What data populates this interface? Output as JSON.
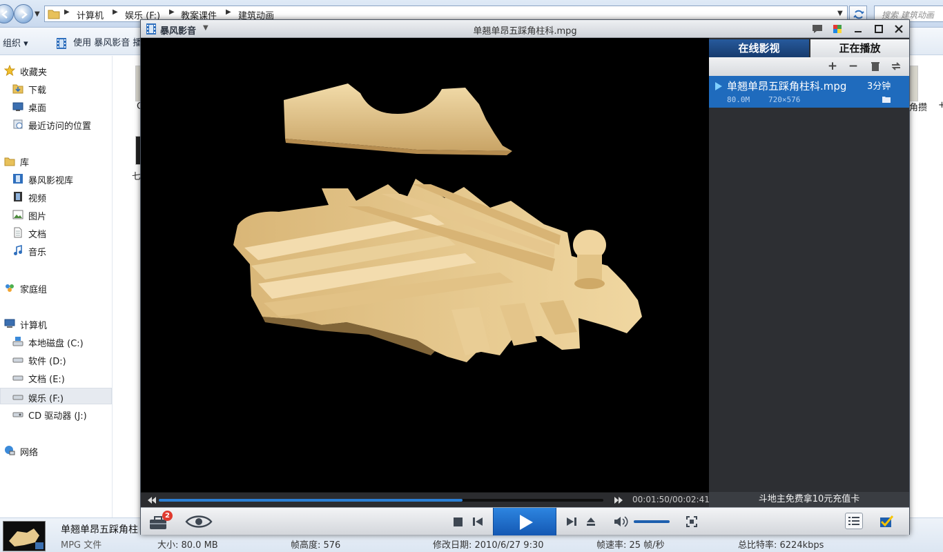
{
  "explorer": {
    "breadcrumbs": [
      "计算机",
      "娱乐 (F:)",
      "教案课件",
      "建筑动画"
    ],
    "search_placeholder": "搜索 建筑动画",
    "toolbar": {
      "organize": "组织",
      "organize_caret": "▾",
      "play_with": "使用 暴风影音 播"
    },
    "nav": {
      "favorites": "收藏夹",
      "downloads": "下载",
      "desktop": "桌面",
      "recent": "最近访问的位置",
      "libraries": "库",
      "baofeng_library": "暴风影视库",
      "videos": "视频",
      "pictures": "图片",
      "documents": "文档",
      "music": "音乐",
      "homegroup": "家庭组",
      "computer": "计算机",
      "drive_c": "本地磁盘 (C:)",
      "drive_d": "软件 (D:)",
      "drive_e": "文档 (E:)",
      "drive_f": "娱乐 (F:)",
      "drive_j": "CD 驱动器 (J:)",
      "network": "网络"
    },
    "file_fragments": {
      "left_1": "C",
      "left_2": "七",
      "right_1": "角攒",
      "right_2": "+"
    },
    "details": {
      "file_name": "单翘单昂五踩角柱",
      "file_type": "MPG 文件",
      "size": "大小: 80.0 MB",
      "frame_height": "帧高度: 576",
      "modified": "修改日期: 2010/6/27 9:30",
      "frame_rate": "帧速率: 25 帧/秒",
      "bitrate": "总比特率: 6224kbps"
    }
  },
  "player": {
    "app_name": "暴风影音",
    "window_title": "单翘单昂五踩角柱科.mpg",
    "tabs": {
      "online": "在线影视",
      "now_playing": "正在播放"
    },
    "playlist": [
      {
        "name": "单翘单昂五踩角柱科.mpg",
        "duration": "3分钟",
        "size": "80.0M",
        "resolution": "720×576"
      }
    ],
    "time": "00:01:50/00:02:41",
    "progress": 0.683,
    "volume": 1.0,
    "ad_text": "斗地主免费拿10元充值卡",
    "notification_count": "2",
    "colors": {
      "accent": "#1f6bbd",
      "wood": "#e6c98d",
      "video_bg": "#000000"
    }
  },
  "icons": [
    "back-icon",
    "forward-icon",
    "folder-icon",
    "refresh-icon",
    "star-icon",
    "stop-icon",
    "prev-icon",
    "play-icon",
    "next-icon",
    "eject-icon",
    "volume-icon",
    "fullscreen-icon",
    "eye-icon",
    "toolbox-icon",
    "playlist-icon",
    "check-icon"
  ]
}
